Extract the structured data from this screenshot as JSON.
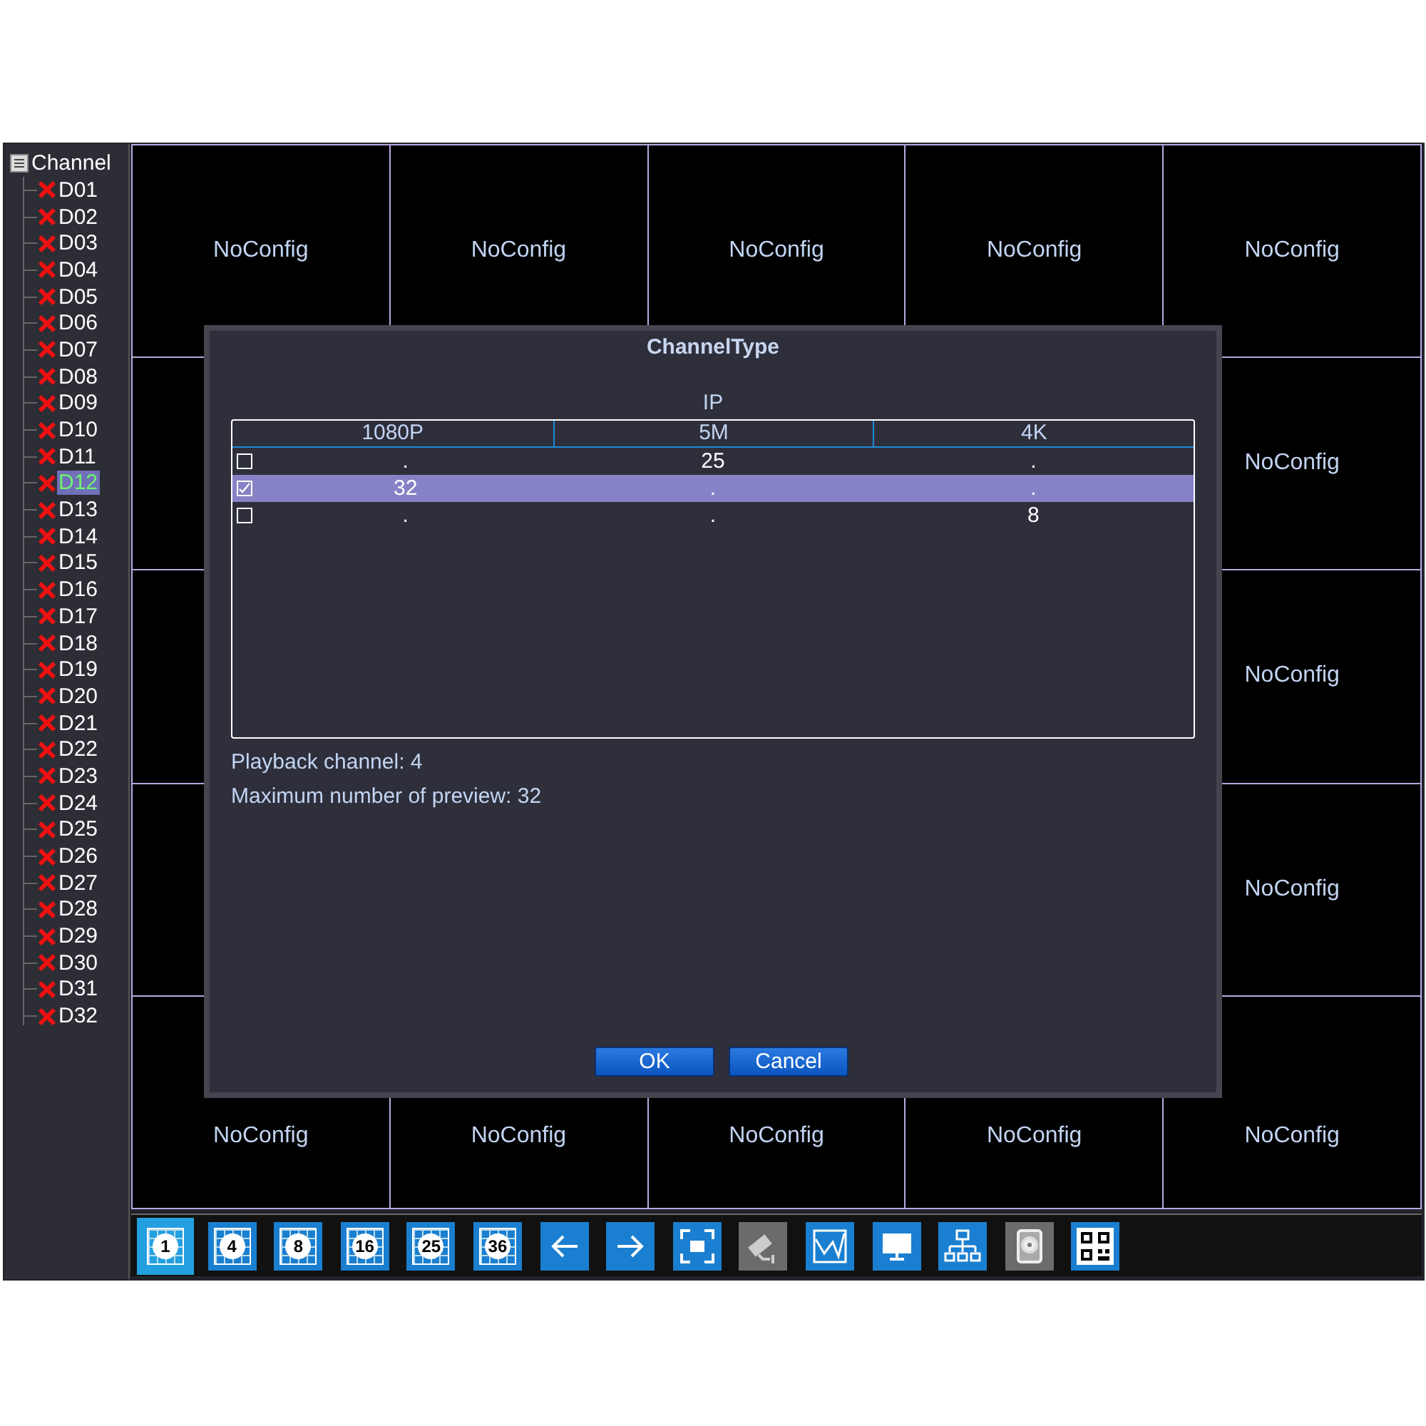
{
  "sidebar": {
    "title": "Channel",
    "items": [
      {
        "label": "D01",
        "selected": false
      },
      {
        "label": "D02",
        "selected": false
      },
      {
        "label": "D03",
        "selected": false
      },
      {
        "label": "D04",
        "selected": false
      },
      {
        "label": "D05",
        "selected": false
      },
      {
        "label": "D06",
        "selected": false
      },
      {
        "label": "D07",
        "selected": false
      },
      {
        "label": "D08",
        "selected": false
      },
      {
        "label": "D09",
        "selected": false
      },
      {
        "label": "D10",
        "selected": false
      },
      {
        "label": "D11",
        "selected": false
      },
      {
        "label": "D12",
        "selected": true
      },
      {
        "label": "D13",
        "selected": false
      },
      {
        "label": "D14",
        "selected": false
      },
      {
        "label": "D15",
        "selected": false
      },
      {
        "label": "D16",
        "selected": false
      },
      {
        "label": "D17",
        "selected": false
      },
      {
        "label": "D18",
        "selected": false
      },
      {
        "label": "D19",
        "selected": false
      },
      {
        "label": "D20",
        "selected": false
      },
      {
        "label": "D21",
        "selected": false
      },
      {
        "label": "D22",
        "selected": false
      },
      {
        "label": "D23",
        "selected": false
      },
      {
        "label": "D24",
        "selected": false
      },
      {
        "label": "D25",
        "selected": false
      },
      {
        "label": "D26",
        "selected": false
      },
      {
        "label": "D27",
        "selected": false
      },
      {
        "label": "D28",
        "selected": false
      },
      {
        "label": "D29",
        "selected": false
      },
      {
        "label": "D30",
        "selected": false
      },
      {
        "label": "D31",
        "selected": false
      },
      {
        "label": "D32",
        "selected": false
      }
    ]
  },
  "grid": [
    [
      "NoConfig",
      "NoConfig",
      "NoConfig",
      "NoConfig",
      "NoConfig"
    ],
    [
      "NoConfig"
    ],
    [
      "NoConfig"
    ],
    [
      "NoConfig"
    ],
    [
      "NoConfig",
      "NoConfig",
      "NoConfig",
      "NoConfig",
      "NoConfig"
    ]
  ],
  "dialog": {
    "title": "ChannelType",
    "group": "IP",
    "columns": [
      "1080P",
      "5M",
      "4K"
    ],
    "rows": [
      {
        "checked": false,
        "selected": false,
        "cells": [
          ".",
          "25",
          "."
        ]
      },
      {
        "checked": true,
        "selected": true,
        "cells": [
          "32",
          ".",
          "."
        ]
      },
      {
        "checked": false,
        "selected": false,
        "cells": [
          ".",
          ".",
          "8"
        ]
      }
    ],
    "info": [
      "Playback channel: 4",
      "Maximum number of preview: 32"
    ],
    "buttons": [
      "OK",
      "Cancel"
    ]
  },
  "toolbar": [
    {
      "kind": "layout",
      "label": "1",
      "selected": true,
      "disabled": false
    },
    {
      "kind": "layout",
      "label": "4",
      "selected": false,
      "disabled": false
    },
    {
      "kind": "layout",
      "label": "8",
      "selected": false,
      "disabled": false
    },
    {
      "kind": "layout",
      "label": "16",
      "selected": false,
      "disabled": false
    },
    {
      "kind": "layout",
      "label": "25",
      "selected": false,
      "disabled": false
    },
    {
      "kind": "layout",
      "label": "36",
      "selected": false,
      "disabled": false
    },
    {
      "kind": "back",
      "selected": false,
      "disabled": false
    },
    {
      "kind": "forward",
      "selected": false,
      "disabled": false
    },
    {
      "kind": "fullscreen",
      "selected": false,
      "disabled": false
    },
    {
      "kind": "camera",
      "selected": false,
      "disabled": true
    },
    {
      "kind": "chart",
      "selected": false,
      "disabled": false
    },
    {
      "kind": "monitor",
      "selected": false,
      "disabled": false
    },
    {
      "kind": "network",
      "selected": false,
      "disabled": false
    },
    {
      "kind": "disk",
      "selected": false,
      "disabled": true
    },
    {
      "kind": "qrcode",
      "selected": false,
      "disabled": false
    }
  ]
}
